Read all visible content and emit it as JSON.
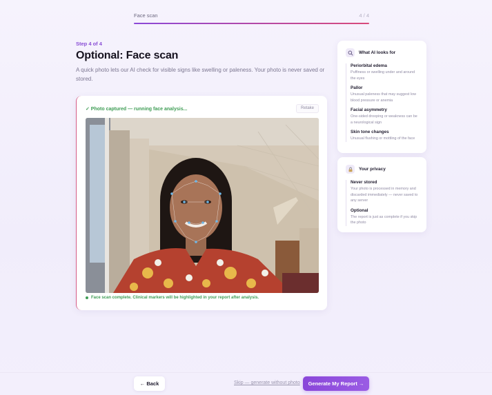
{
  "progress": {
    "label": "Face scan",
    "count": "4 / 4",
    "fraction": 1.0
  },
  "header": {
    "step": "Step 4 of 4",
    "title": "Optional: Face scan",
    "subtitle": "A quick photo lets our AI check for visible signs like swelling or paleness. Your photo is never saved or stored."
  },
  "capture": {
    "status": "✓ Photo captured — running face analysis...",
    "retake_label": "Retake",
    "footer": "Face scan complete. Clinical markers will be highlighted in your report after analysis."
  },
  "ai_card": {
    "icon": "search-icon",
    "title": "What AI looks for",
    "items": [
      {
        "title": "Periorbital edema",
        "desc": "Puffiness or swelling under and around the eyes"
      },
      {
        "title": "Pallor",
        "desc": "Unusual paleness that may suggest low blood pressure or anemia"
      },
      {
        "title": "Facial asymmetry",
        "desc": "One-sided drooping or weakness can be a neurological sign"
      },
      {
        "title": "Skin tone changes",
        "desc": "Unusual flushing or mottling of the face"
      }
    ]
  },
  "privacy_card": {
    "icon": "lock-icon",
    "title": "Your privacy",
    "items": [
      {
        "title": "Never stored",
        "desc": "Your photo is processed in memory and discarded immediately — never saved to any server"
      },
      {
        "title": "Optional",
        "desc": "The report is just as complete if you skip the photo"
      }
    ]
  },
  "footer": {
    "back_label": "← Back",
    "skip_label": "Skip — generate without photo",
    "generate_label": "Generate My Report →"
  },
  "colors": {
    "accent": "#8a47d9",
    "success": "#3f9d55",
    "progress_end": "#d94a7a"
  }
}
